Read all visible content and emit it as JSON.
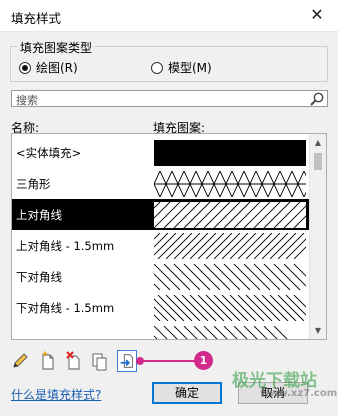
{
  "window": {
    "title": "填充样式",
    "close_glyph": "✕"
  },
  "group": {
    "legend": "填充图案类型",
    "options": [
      {
        "label": "绘图(R)",
        "selected": true
      },
      {
        "label": "模型(M)",
        "selected": false
      }
    ]
  },
  "search": {
    "placeholder": "搜索",
    "icon": "search-icon"
  },
  "columns": {
    "name": "名称:",
    "pattern": "填充图案:"
  },
  "patterns": [
    {
      "name": "<实体填充>",
      "pattern": "solid",
      "selected": false
    },
    {
      "name": "三角形",
      "pattern": "triangle",
      "selected": false
    },
    {
      "name": "上对角线",
      "pattern": "diagonal-up",
      "selected": true
    },
    {
      "name": "上对角线 - 1.5mm",
      "pattern": "diagonal-up-dense",
      "selected": false
    },
    {
      "name": "下对角线",
      "pattern": "diagonal-down",
      "selected": false
    },
    {
      "name": "下对角线 - 1.5mm",
      "pattern": "diagonal-down-dense",
      "selected": false
    },
    {
      "name": "",
      "pattern": "diagonal-down",
      "selected": false
    }
  ],
  "toolbar": {
    "icons": [
      "pencil-icon",
      "new-pattern-icon",
      "delete-pattern-icon",
      "duplicate-icon",
      "import-icon"
    ]
  },
  "annotation": {
    "badge": "1",
    "color": "#d12a8c"
  },
  "footer": {
    "help_link": "什么是填充样式?",
    "ok_label": "确定",
    "cancel_label": "取消"
  },
  "watermark": {
    "text": "极光下载站",
    "url_text": "www.xz7.com"
  }
}
